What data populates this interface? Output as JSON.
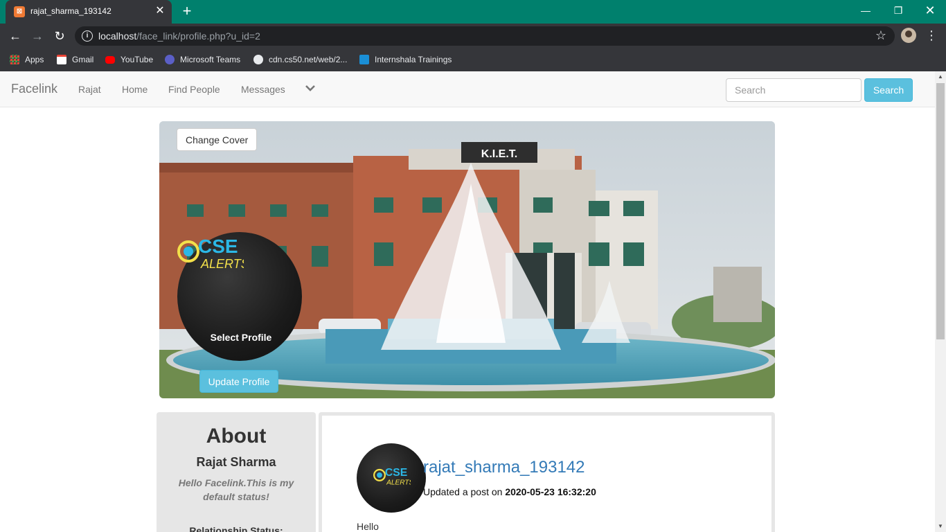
{
  "browser": {
    "tab_title": "rajat_sharma_193142",
    "tab_favicon_glyph": "⊠",
    "url_host": "localhost",
    "url_path": "/face_link/profile.php?u_id=2",
    "bookmarks": [
      {
        "label": "Apps",
        "icon": "apps-grid-icon"
      },
      {
        "label": "Gmail",
        "icon": "gmail-icon"
      },
      {
        "label": "YouTube",
        "icon": "youtube-icon"
      },
      {
        "label": "Microsoft Teams",
        "icon": "teams-icon"
      },
      {
        "label": "cdn.cs50.net/web/2...",
        "icon": "globe-icon"
      },
      {
        "label": "Internshala Trainings",
        "icon": "internshala-icon"
      }
    ],
    "accent_color": "#00806d"
  },
  "navbar": {
    "brand": "Facelink",
    "links": [
      "Rajat",
      "Home",
      "Find People",
      "Messages"
    ],
    "search_placeholder": "Search",
    "search_button": "Search"
  },
  "cover": {
    "change_cover_label": "Change Cover",
    "building_sign": "K.I.E.T.",
    "select_profile_label": "Select Profile",
    "update_profile_label": "Update Profile"
  },
  "about": {
    "heading": "About",
    "name": "Rajat Sharma",
    "status": "Hello Facelink.This is my default status!",
    "relationship_label": "Relationship Status:"
  },
  "post": {
    "username": "rajat_sharma_193142",
    "meta_prefix": "Updated a post on",
    "timestamp": "2020-05-23 16:32:20",
    "body": "Hello"
  }
}
